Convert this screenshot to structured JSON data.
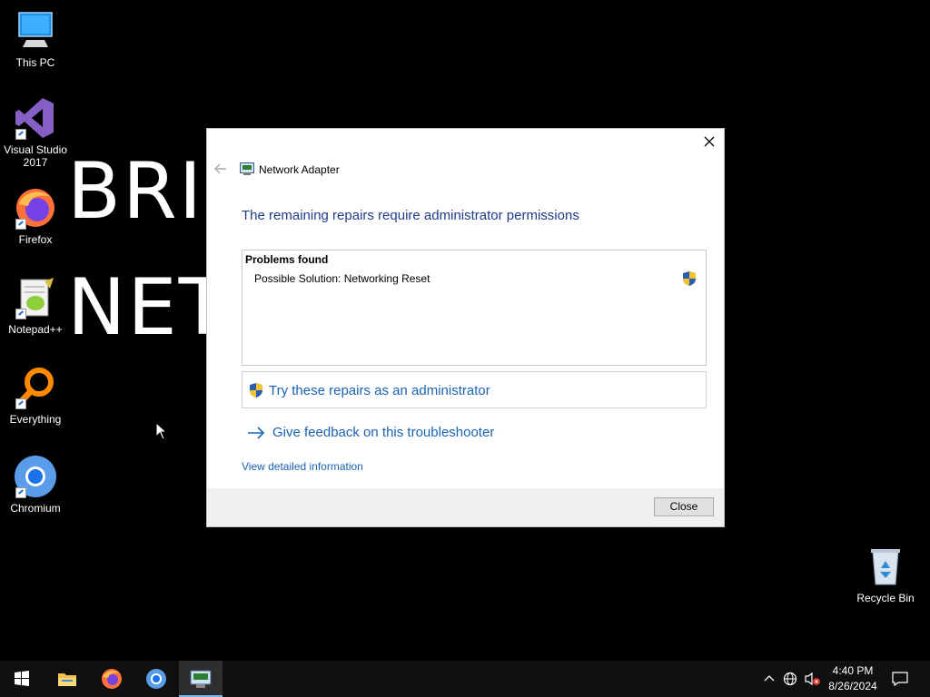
{
  "wallpaper": {
    "line1": "BRI",
    "line2": "NET"
  },
  "desktop_icons": [
    {
      "label": "This PC",
      "icon": "this-pc-icon"
    },
    {
      "label": "Visual Studio 2017",
      "icon": "visual-studio-icon"
    },
    {
      "label": "Firefox",
      "icon": "firefox-icon"
    },
    {
      "label": "Notepad++",
      "icon": "notepad-plus-plus-icon"
    },
    {
      "label": "Everything",
      "icon": "everything-search-icon"
    },
    {
      "label": "Chromium",
      "icon": "chromium-icon"
    }
  ],
  "recycle_bin": {
    "label": "Recycle Bin",
    "icon": "recycle-bin-icon"
  },
  "dialog": {
    "title": "Network Adapter",
    "heading": "The remaining repairs require administrator permissions",
    "problems_title": "Problems found",
    "problem_item": "Possible Solution: Networking Reset",
    "admin_button": "Try these repairs as an administrator",
    "feedback_link": "Give feedback on this troubleshooter",
    "details_link": "View detailed information",
    "close_button": "Close"
  },
  "taskbar": {
    "apps": [
      "start-icon",
      "file-explorer-icon",
      "firefox-icon",
      "chromium-icon",
      "network-troubleshooter-icon"
    ],
    "clock_time": "4:40 PM",
    "clock_date": "8/26/2024"
  },
  "colors": {
    "link": "#1a63b5",
    "heading": "#1e3c8c",
    "taskbar": "#101010",
    "active_indicator": "#76b9ed"
  }
}
